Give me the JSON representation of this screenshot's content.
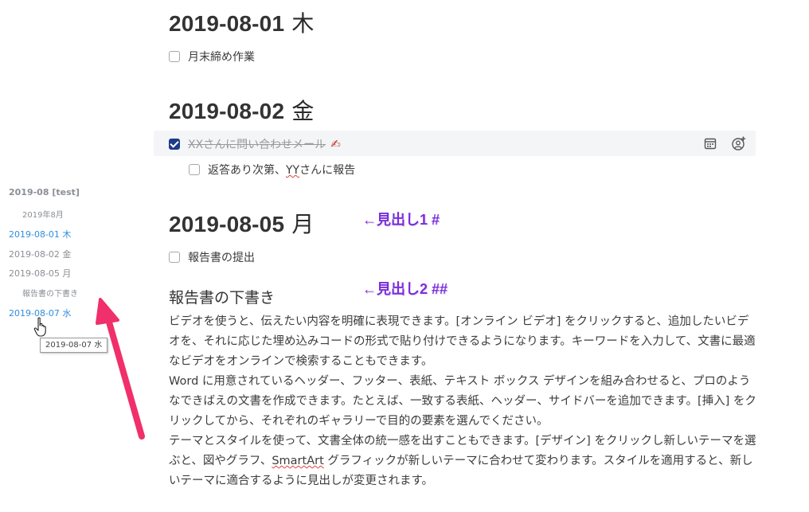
{
  "outline": {
    "items": [
      {
        "label": "2019-08 [test]"
      },
      {
        "label": "2019年8月"
      },
      {
        "label": "2019-08-01 木"
      },
      {
        "label": "2019-08-02 金"
      },
      {
        "label": "2019-08-05 月"
      },
      {
        "label": "報告書の下書き"
      },
      {
        "label": "2019-08-07 水"
      }
    ],
    "tooltip": "2019-08-07 水"
  },
  "main": {
    "day1": {
      "date": "2019-08-01",
      "weekday": "木",
      "tasks": [
        {
          "label": "月末締め作業",
          "checked": false
        }
      ]
    },
    "day2": {
      "date": "2019-08-02",
      "weekday": "金",
      "task_done": {
        "label": "XXさんに問い合わせメール",
        "checked": true
      },
      "subtask": {
        "label_a": "返答あり次第、",
        "label_b": "YY",
        "label_c": "さんに報告",
        "checked": false
      }
    },
    "day3": {
      "date": "2019-08-05",
      "weekday": "月",
      "tasks": [
        {
          "label": "報告書の提出",
          "checked": false
        }
      ]
    },
    "section_heading": "報告書の下書き",
    "paragraphs": [
      "ビデオを使うと、伝えたい内容を明確に表現できます。[オンライン ビデオ] をクリックすると、追加したいビデオを、それに応じた埋め込みコードの形式で貼り付けできるようになります。キーワードを入力して、文書に最適なビデオをオンラインで検索することもできます。",
      "Word に用意されているヘッダー、フッター、表紙、テキスト ボックス デザインを組み合わせると、プロのようなできばえの文書を作成できます。たとえば、一致する表紙、ヘッダー、サイドバーを追加できます。[挿入] をクリックしてから、それぞれのギャラリーで目的の要素を選んでください。",
      "テーマとスタイルを使って、文書全体の統一感を出すこともできます。[デザイン] をクリックし新しいテーマを選ぶと、図やグラフ、",
      "SmartArt",
      " グラフィックが新しいテーマに合わせて変わります。スタイルを適用すると、新しいテーマに適合するように見出しが変更されます。"
    ]
  },
  "annotations": {
    "heading1": "←見出し1 #",
    "heading2": "←見出し2 ##"
  },
  "colors": {
    "link_blue": "#2f8ee0",
    "annotation_purple": "#7a2fd8",
    "arrow_pink": "#f0306a",
    "checkbox_checked": "#1f3a8a"
  },
  "icons": [
    "calendar-icon",
    "add-person-icon",
    "pen-emoji-icon",
    "hand-cursor-icon",
    "checkbox-icon"
  ]
}
